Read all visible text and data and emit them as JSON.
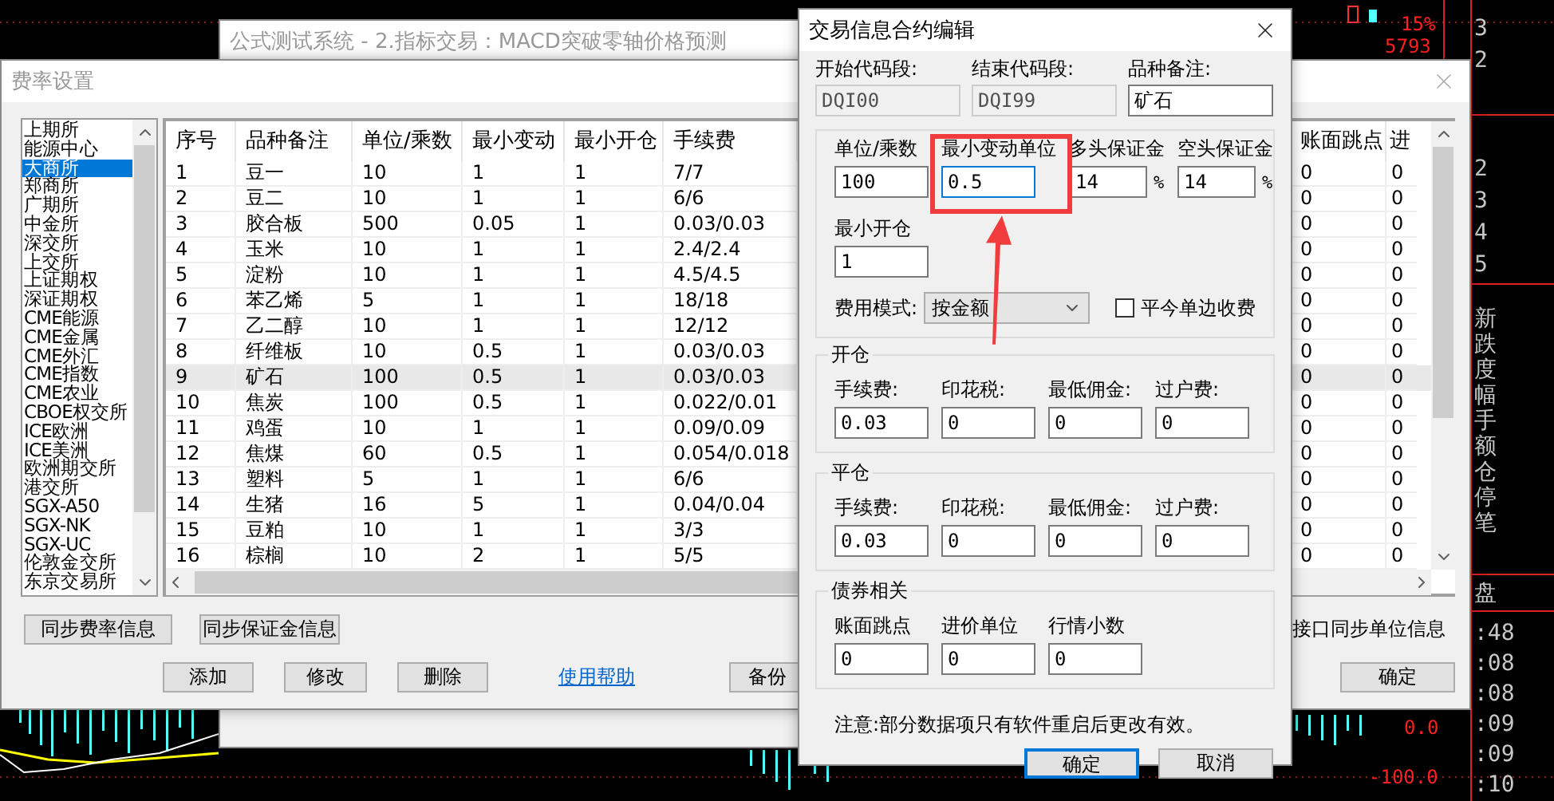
{
  "background_window": {
    "title": "公式测试系统 - 2.指标交易：MACD突破零轴价格预测"
  },
  "chart": {
    "percent": "15%",
    "price": "5793",
    "top_ticks": [
      "3",
      "2"
    ],
    "depth_ticks": [
      "2",
      "3",
      "4",
      "5"
    ],
    "field_labels": [
      "新",
      "跌",
      "度",
      "幅",
      "手",
      "额",
      "仓",
      "停",
      "笔"
    ],
    "close_label": "盘",
    "times": [
      ":48",
      ":08",
      ":08",
      ":09",
      ":09",
      ":10"
    ],
    "zero_value": "0.0",
    "low_value": "-100.0"
  },
  "fee_window": {
    "title": "费率设置",
    "exchanges": [
      {
        "label": "上期所",
        "selected": false
      },
      {
        "label": "能源中心",
        "selected": false
      },
      {
        "label": "大商所",
        "selected": true
      },
      {
        "label": "郑商所",
        "selected": false
      },
      {
        "label": "广期所",
        "selected": false
      },
      {
        "label": "中金所",
        "selected": false
      },
      {
        "label": "深交所",
        "selected": false
      },
      {
        "label": "上交所",
        "selected": false
      },
      {
        "label": "上证期权",
        "selected": false
      },
      {
        "label": "深证期权",
        "selected": false
      },
      {
        "label": "CME能源",
        "selected": false
      },
      {
        "label": "CME金属",
        "selected": false
      },
      {
        "label": "CME外汇",
        "selected": false
      },
      {
        "label": "CME指数",
        "selected": false
      },
      {
        "label": "CME农业",
        "selected": false
      },
      {
        "label": "CBOE权交所",
        "selected": false
      },
      {
        "label": "ICE欧洲",
        "selected": false
      },
      {
        "label": "ICE美洲",
        "selected": false
      },
      {
        "label": "欧洲期交所",
        "selected": false
      },
      {
        "label": "港交所",
        "selected": false
      },
      {
        "label": "SGX-A50",
        "selected": false
      },
      {
        "label": "SGX-NK",
        "selected": false
      },
      {
        "label": "SGX-UC",
        "selected": false
      },
      {
        "label": "伦敦金交所",
        "selected": false
      },
      {
        "label": "东京交易所",
        "selected": false
      }
    ],
    "table": {
      "columns": [
        "序号",
        "品种备注",
        "单位/乘数",
        "最小变动",
        "最小开仓",
        "手续费",
        "账面跳点",
        "进"
      ],
      "rows": [
        {
          "cells": [
            "1",
            "豆一",
            "10",
            "1",
            "1",
            "7/7",
            "0",
            "0"
          ],
          "selected": false
        },
        {
          "cells": [
            "2",
            "豆二",
            "10",
            "1",
            "1",
            "6/6",
            "0",
            "0"
          ],
          "selected": false
        },
        {
          "cells": [
            "3",
            "胶合板",
            "500",
            "0.05",
            "1",
            "0.03/0.03",
            "0",
            "0"
          ],
          "selected": false
        },
        {
          "cells": [
            "4",
            "玉米",
            "10",
            "1",
            "1",
            "2.4/2.4",
            "0",
            "0"
          ],
          "selected": false
        },
        {
          "cells": [
            "5",
            "淀粉",
            "10",
            "1",
            "1",
            "4.5/4.5",
            "0",
            "0"
          ],
          "selected": false
        },
        {
          "cells": [
            "6",
            "苯乙烯",
            "5",
            "1",
            "1",
            "18/18",
            "0",
            "0"
          ],
          "selected": false
        },
        {
          "cells": [
            "7",
            "乙二醇",
            "10",
            "1",
            "1",
            "12/12",
            "0",
            "0"
          ],
          "selected": false
        },
        {
          "cells": [
            "8",
            "纤维板",
            "10",
            "0.5",
            "1",
            "0.03/0.03",
            "0",
            "0"
          ],
          "selected": false
        },
        {
          "cells": [
            "9",
            "矿石",
            "100",
            "0.5",
            "1",
            "0.03/0.03",
            "0",
            "0"
          ],
          "selected": true
        },
        {
          "cells": [
            "10",
            "焦炭",
            "100",
            "0.5",
            "1",
            "0.022/0.01",
            "0",
            "0"
          ],
          "selected": false
        },
        {
          "cells": [
            "11",
            "鸡蛋",
            "10",
            "1",
            "1",
            "0.09/0.09",
            "0",
            "0"
          ],
          "selected": false
        },
        {
          "cells": [
            "12",
            "焦煤",
            "60",
            "0.5",
            "1",
            "0.054/0.018",
            "0",
            "0"
          ],
          "selected": false
        },
        {
          "cells": [
            "13",
            "塑料",
            "5",
            "1",
            "1",
            "6/6",
            "0",
            "0"
          ],
          "selected": false
        },
        {
          "cells": [
            "14",
            "生猪",
            "16",
            "5",
            "1",
            "0.04/0.04",
            "0",
            "0"
          ],
          "selected": false
        },
        {
          "cells": [
            "15",
            "豆粕",
            "10",
            "1",
            "1",
            "3/3",
            "0",
            "0"
          ],
          "selected": false
        },
        {
          "cells": [
            "16",
            "棕榈",
            "10",
            "2",
            "1",
            "5/5",
            "0",
            "0"
          ],
          "selected": false
        }
      ]
    },
    "sync_buttons": [
      "同步费率信息",
      "同步保证金信息"
    ],
    "sync_checkbox_label": "接口同步单位信息",
    "action_buttons": [
      "添加",
      "修改",
      "删除"
    ],
    "help_link": "使用帮助",
    "backup_button": "备份",
    "ok_button": "确定"
  },
  "dialog": {
    "title": "交易信息合约编辑",
    "header_fields": [
      {
        "label": "开始代码段:",
        "value": "DQI00",
        "disabled": true
      },
      {
        "label": "结束代码段:",
        "value": "DQI99",
        "disabled": true
      },
      {
        "label": "品种备注:",
        "value": "矿石",
        "disabled": false
      }
    ],
    "contract_fields": [
      {
        "label": "单位/乘数",
        "value": "100",
        "focused": false
      },
      {
        "label": "最小变动单位",
        "value": "0.5",
        "focused": true
      },
      {
        "label": "多头保证金",
        "value": "14",
        "suffix": "%",
        "focused": false
      },
      {
        "label": "空头保证金",
        "value": "14",
        "suffix": "%",
        "focused": false
      }
    ],
    "min_open": {
      "label": "最小开仓",
      "value": "1"
    },
    "fee_mode": {
      "label": "费用模式:",
      "value": "按金额"
    },
    "close_today_checkbox": {
      "label": "平今单边收费",
      "checked": false
    },
    "groups": [
      {
        "title": "开仓",
        "fields": [
          {
            "label": "手续费:",
            "value": "0.03"
          },
          {
            "label": "印花税:",
            "value": "0"
          },
          {
            "label": "最低佣金:",
            "value": "0"
          },
          {
            "label": "过户费:",
            "value": "0"
          }
        ]
      },
      {
        "title": "平仓",
        "fields": [
          {
            "label": "手续费:",
            "value": "0.03"
          },
          {
            "label": "印花税:",
            "value": "0"
          },
          {
            "label": "最低佣金:",
            "value": "0"
          },
          {
            "label": "过户费:",
            "value": "0"
          }
        ]
      },
      {
        "title": "债券相关",
        "fields": [
          {
            "label": "账面跳点",
            "value": "0"
          },
          {
            "label": "进价单位",
            "value": "0"
          },
          {
            "label": "行情小数",
            "value": "0"
          }
        ]
      }
    ],
    "note": "注意:部分数据项只有软件重启后更改有效。",
    "buttons": [
      {
        "label": "确定",
        "default": true
      },
      {
        "label": "取消",
        "default": false
      }
    ]
  }
}
